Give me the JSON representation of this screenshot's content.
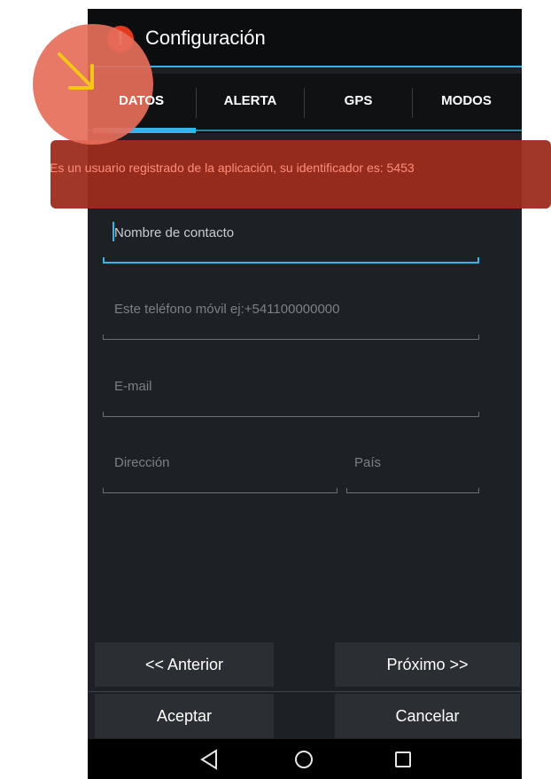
{
  "app": {
    "title": "Configuración",
    "icon": "alert-exclamation-icon",
    "icon_glyph": "!"
  },
  "tabs": [
    {
      "label": "DATOS",
      "selected": true
    },
    {
      "label": "ALERTA",
      "selected": false
    },
    {
      "label": "GPS",
      "selected": false
    },
    {
      "label": "MODOS",
      "selected": false
    }
  ],
  "notice": {
    "text": "Es un usuario registrado de la aplicación, su identificador es: 5453"
  },
  "form": {
    "contact_name": {
      "placeholder": "Nombre de contacto",
      "value": ""
    },
    "mobile": {
      "placeholder": "Este teléfono móvil ej:+541100000000",
      "value": ""
    },
    "email": {
      "placeholder": "E-mail",
      "value": ""
    },
    "address": {
      "placeholder": "Dirección",
      "value": ""
    },
    "country": {
      "placeholder": "País",
      "value": ""
    }
  },
  "buttons": {
    "previous": "<< Anterior",
    "next": "Próximo >>",
    "accept": "Aceptar",
    "cancel": "Cancelar"
  },
  "navbar": {
    "back_icon": "back-triangle-icon",
    "home_icon": "home-circle-icon",
    "recents_icon": "recents-square-icon"
  },
  "colors": {
    "accent": "#35b5e5",
    "notice_bg": "#9c2c1c",
    "notice_text": "#ff8c7a",
    "overlay": "#e66e5a",
    "arrow": "#f5c518"
  }
}
